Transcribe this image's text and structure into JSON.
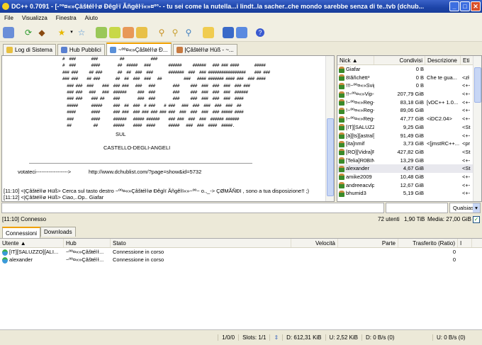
{
  "window": {
    "title": "DC++ 0.7091 - [-°º¤«»Çâšŧéŀŀø Đêgŀï Ăñgêŀï«»¤º°- - tu sei come la nutella...i lindt..la sacher..che mondo sarebbe senza di te..tvb (dchub...",
    "minimize": "_",
    "maximize": "□",
    "close": "✕"
  },
  "menu": [
    "File",
    "Visualizza",
    "Finestra",
    "Aiuto"
  ],
  "toolbar_icons": [
    "public-hubs-icon",
    "reconnect-icon",
    "follow-redirect-icon",
    "favorite-hubs-icon",
    "dropdown-icon",
    "favorite-users-icon",
    "queue-icon",
    "finished-downloads-icon",
    "upload-queue-icon",
    "finished-uploads-icon",
    "search-icon",
    "adl-search-icon",
    "search-spy-icon",
    "open-file-list-icon",
    "settings-icon",
    "notepad-icon",
    "help-icon"
  ],
  "tabs": [
    {
      "label": "Log di Sistema",
      "active": false
    },
    {
      "label": "Hub Pubblici",
      "active": false
    },
    {
      "label": "~ºº¤«»Çâšŧéŀŀø Đ...",
      "active": true
    },
    {
      "label": "ĮÇâšŧéŀŀø Hüß - ~...",
      "active": false
    }
  ],
  "chat": {
    "art": [
      "#  ###       ###          ##            ###",
      "#  ###       ####        ##  #####   ###        ######     ######   ### ### ####       #####",
      "### ###     ## ###       ##  ##  ###  ###       #######  ###  ### #################    ### ###",
      "### ###    ## ###       ##  ##  ###  ###   ##          ###   #### ####### #### ###  ### ####",
      "  ### ###  ###    ###  ### ###   ###   ###        ###     ###  ###  ###  ###  ### ###",
      "  ### ###   ###   ###  ######     ###  ###        ###     ###  ###  ###  ###  ######",
      "  ### ###    ### ##    ###        ###  ###        ###     ###  ###  ###  ###  ####",
      "  #####      #####     ###  ##  ###  # ###    # ###   ###  ###  ###  ###  ###  ##",
      "  ####       ####      ### ###  ### ### ### ### ###  ###  ###  ###  ### ##### ####",
      "  ###        ####      ######   ##### ######    ### ###  ###  ###  ###### ######",
      "  ##          ##       #####    ####  ####      #####   ###  ###  ####  #####."
    ],
    "sul": "SUL",
    "castello": "CASTELLO-DEGLI-ANGELI",
    "votateci": "votateci------------------>",
    "url": "http://www.dchublist.com/?page=show&id=5732",
    "messages": [
      "[11:10] <ĮÇâšŧéŀŀø Hüß> Cerca sul tasto destro ~ºº¤«»Çâšŧéŀŀø Đêgŀï Ăñgêŀï«»~ºº~ o.,_-> ÇØMÃÑĐI , sono a tua disposizione!! ;)",
      "[11:12] <ĮÇâšŧéŀŀø Hüß> Ciao,..Op.. Giafar"
    ]
  },
  "userlist": {
    "columns": [
      "Nick",
      "Condivisi",
      "Descrizione",
      "Eti"
    ],
    "rows": [
      [
        "Giafar",
        "0 B",
        "",
        ""
      ],
      [
        "8ïăñchëtt³",
        "0 B",
        "Che te gua...",
        "<zł"
      ],
      [
        "!!!~ºº¤«»Svip-...",
        "0 B",
        "",
        "<+-"
      ],
      [
        "!!~ºº¤«»Vip-V...",
        "207,79 GiB",
        "",
        "<+-"
      ],
      [
        "!~ºº¤«»Reg-F...",
        "83,18 GiB",
        "[vDC++ 1.0...",
        "<+-"
      ],
      [
        "!~ºº¤«»Reg-P...",
        "89,06 GiB",
        "",
        "<+-"
      ],
      [
        "!~ºº¤«»Reg-V...",
        "47,77 GiB",
        "<iDC2.04>",
        "<+-"
      ],
      [
        "[IT][SALUZZ...",
        "9,25 GiB",
        "",
        "<St"
      ],
      [
        "[ä][ts][astral][d...",
        "91,49 GiB",
        "",
        "<+-"
      ],
      [
        "[ita]nmif",
        "3,73 GiB",
        "<[jmstRC++...",
        "<pr"
      ],
      [
        "[RO][Vidra]Pitzy",
        "427,82 GiB",
        "",
        "<St"
      ],
      [
        "[Telia]R0BIN",
        "13,29 GiB",
        "",
        "<+-"
      ],
      [
        "alexander",
        "4,67 GiB",
        "",
        "<St"
      ],
      [
        "amike2009",
        "10,48 GiB",
        "",
        "<+-"
      ],
      [
        "andreeacvlp",
        "12,67 GiB",
        "",
        "<+-"
      ],
      [
        "bhumid3",
        "5,19 GiB",
        "",
        "<+-"
      ]
    ]
  },
  "search": {
    "filter_value": "",
    "type": "Qualsias"
  },
  "hubstatus": {
    "message": "[11:10] Connesso",
    "users": "72 utenti",
    "shared": "1,90 TiB",
    "average": "Media: 27,00 GiB"
  },
  "bottom_tabs": [
    "Connessioni",
    "Downloads"
  ],
  "transfers": {
    "columns": [
      "Utente",
      "Hub",
      "Stato",
      "Velocità",
      "Parte",
      "Trasferito (Ratio)",
      "I"
    ],
    "rows": [
      [
        "[IT][SALUZZO][ALI...",
        "~ºº¤«»Çâšŧéŀŀ...",
        "Connessione in corso",
        "",
        "",
        "0"
      ],
      [
        "alexander",
        "~ºº¤«»Çâšŧéŀŀ...",
        "Connessione in corso",
        "",
        "",
        "0"
      ]
    ]
  },
  "statusbar": {
    "hubs": "1/0/0",
    "slots": "Slots: 1/1",
    "downloaded": "D: 612,31 KiB",
    "uploaded": "U: 2,52 KiB",
    "down_rate": "D: 0 B/s (0)",
    "up_rate": "U: 0 B/s (0)"
  }
}
